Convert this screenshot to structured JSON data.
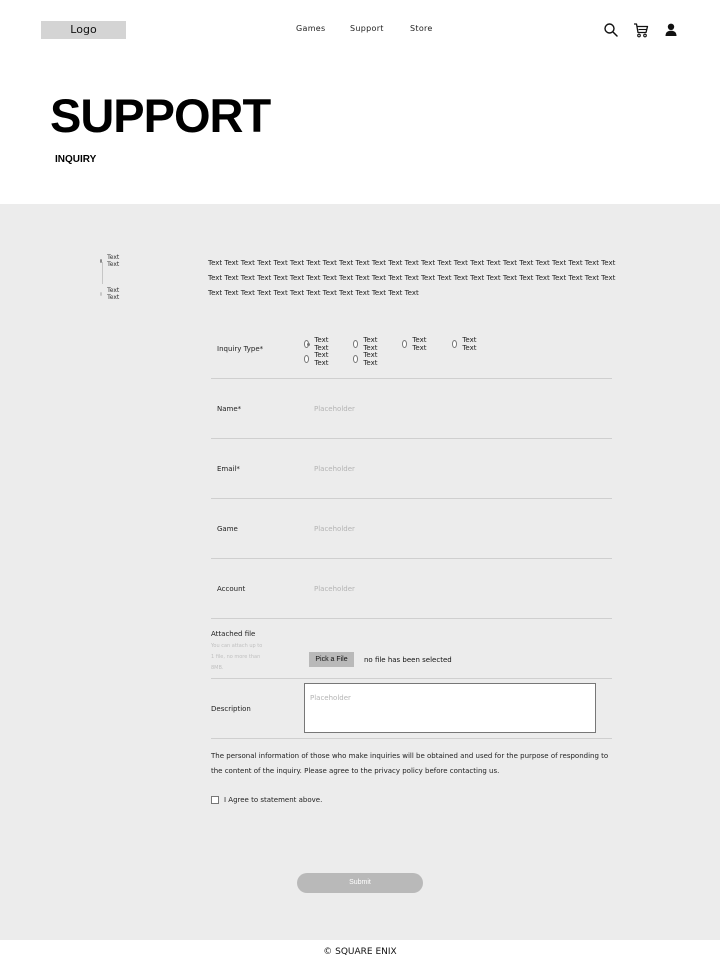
{
  "header": {
    "logo": "Logo",
    "nav": [
      "Games",
      "Support",
      "Store"
    ],
    "icons": [
      "search-icon",
      "cart-icon",
      "user-icon"
    ]
  },
  "hero": {
    "title": "SUPPORT",
    "subtitle": "INQUIRY"
  },
  "stepper": {
    "steps": [
      "Text Text",
      "Text Text"
    ]
  },
  "intro": "Text Text Text Text Text Text Text Text Text Text Text Text Text Text Text Text Text Text Text Text Text Text Text Text Text Text Text Text Text Text Text Text Text Text Text Text Text Text Text Text Text Text Text Text Text Text Text Text Text Text Text Text Text Text Text Text  Text Text Text Text Text Text Text",
  "form": {
    "inquiry_type": {
      "label": "Inquiry Type*",
      "options": [
        "Text Text",
        "Text Text",
        "Text Text",
        "Text Text",
        "Text Text",
        "Text Text"
      ],
      "selected_index": 0
    },
    "name": {
      "label": "Name*",
      "placeholder": "Placeholder"
    },
    "email": {
      "label": "Email*",
      "placeholder": "Placeholder"
    },
    "game": {
      "label": "Game",
      "placeholder": "Placeholder"
    },
    "account": {
      "label": "Account",
      "placeholder": "Placeholder"
    },
    "attached_file": {
      "label": "Attached file",
      "hint": "You can attach up to 1 file, no more than 8MB.",
      "button": "Pick a File",
      "status": "no file has been selected"
    },
    "description": {
      "label": "Description",
      "placeholder": "Placeholder"
    },
    "privacy_text": "The personal information of those who make inquiries will be obtained and used for the purpose of responding to the content of the inquiry. Please agree to the privacy policy before contacting us.",
    "agree_label": "I Agree to statement above.",
    "submit_label": "Submit"
  },
  "footer": "© SQUARE ENIX",
  "colors": {
    "background": "#ffffff",
    "section": "#ececec",
    "button": "#b9b9b9",
    "logo_box": "#d4d4d4"
  }
}
